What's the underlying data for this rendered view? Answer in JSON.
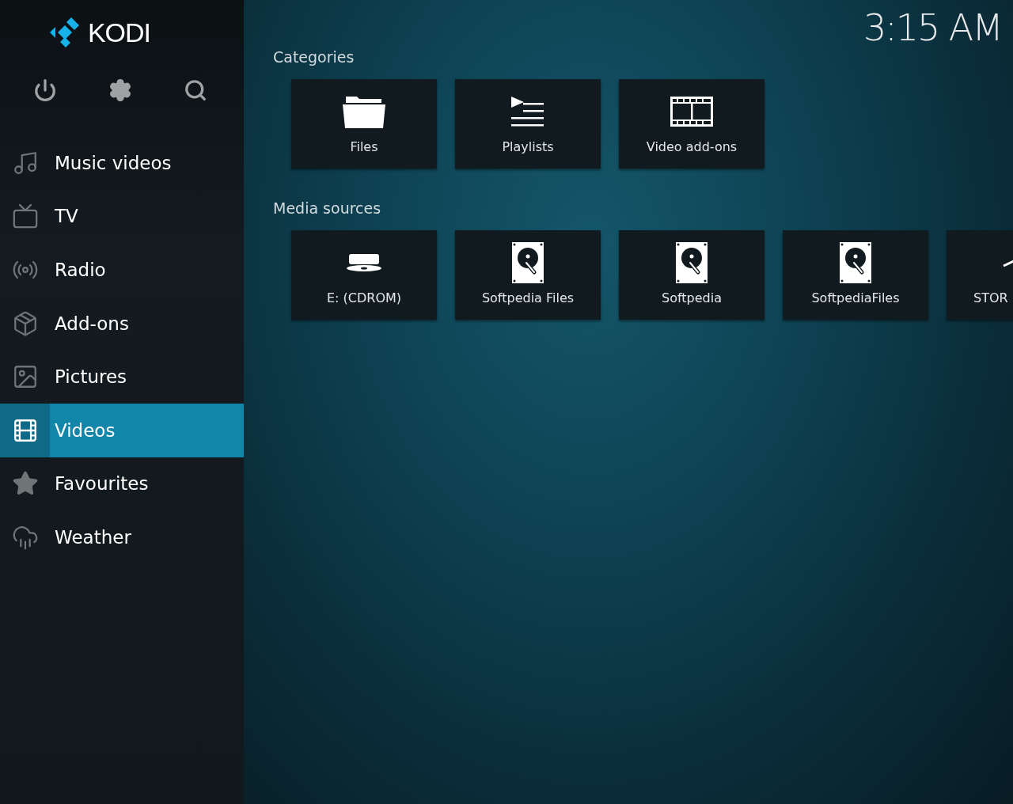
{
  "logo": {
    "text": "KODI"
  },
  "clock": "3:15 AM",
  "sidebar": {
    "items": [
      {
        "label": "Music videos",
        "kind": "musicvideo",
        "selected": false
      },
      {
        "label": "TV",
        "kind": "tv",
        "selected": false
      },
      {
        "label": "Radio",
        "kind": "radio",
        "selected": false
      },
      {
        "label": "Add-ons",
        "kind": "addons",
        "selected": false
      },
      {
        "label": "Pictures",
        "kind": "pictures",
        "selected": false
      },
      {
        "label": "Videos",
        "kind": "videos",
        "selected": true
      },
      {
        "label": "Favourites",
        "kind": "star",
        "selected": false
      },
      {
        "label": "Weather",
        "kind": "weather",
        "selected": false
      }
    ]
  },
  "sections": [
    {
      "title": "Categories",
      "tiles": [
        {
          "label": "Files",
          "kind": "folder"
        },
        {
          "label": "Playlists",
          "kind": "playlist"
        },
        {
          "label": "Video add-ons",
          "kind": "film"
        }
      ]
    },
    {
      "title": "Media sources",
      "tiles": [
        {
          "label": "E: (CDROM)",
          "kind": "disc"
        },
        {
          "label": "Softpedia Files",
          "kind": "drive"
        },
        {
          "label": "Softpedia",
          "kind": "drive"
        },
        {
          "label": "SoftpediaFiles",
          "kind": "drive"
        },
        {
          "label": "STOR",
          "kind": "partial"
        }
      ]
    }
  ]
}
